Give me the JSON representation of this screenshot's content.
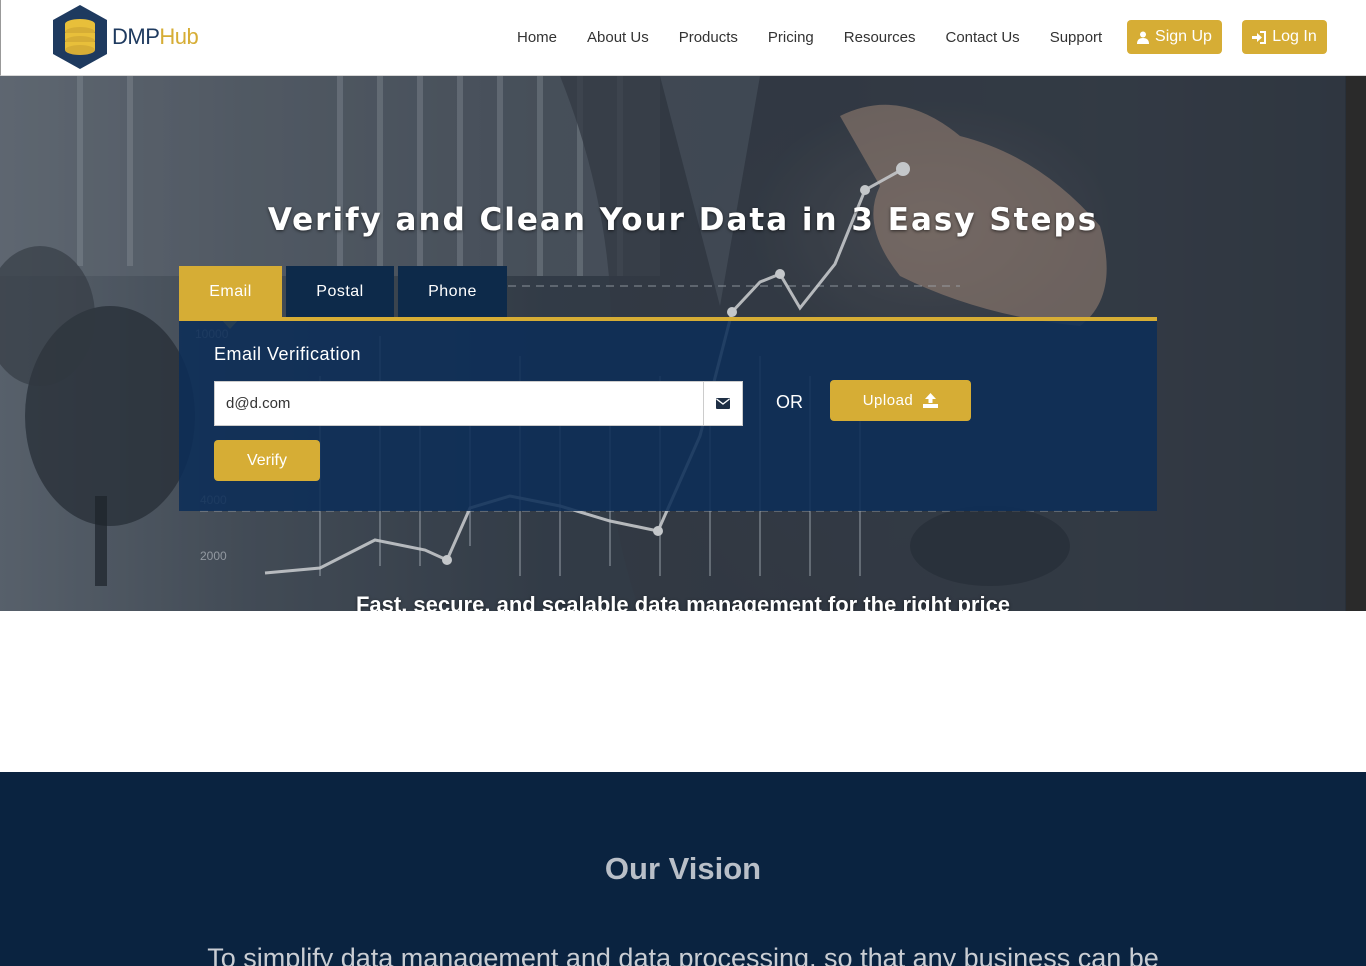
{
  "brand": {
    "name_part1": "DMP",
    "name_part2": "Hub",
    "logo_icon": "database-hexagon-icon",
    "primary_color": "#0c2d58",
    "accent_color": "#d6ad35"
  },
  "nav": {
    "items": [
      "Home",
      "About Us",
      "Products",
      "Pricing",
      "Resources",
      "Contact Us",
      "Support"
    ],
    "signup": {
      "label": "Sign Up",
      "icon": "user-icon"
    },
    "login": {
      "label": "Log In",
      "icon": "sign-in-icon"
    }
  },
  "hero": {
    "title": "Verify and Clean Your Data in 3 Easy Steps",
    "tagline": "Fast, secure, and scalable data management for the right price",
    "tabs": [
      "Email",
      "Postal",
      "Phone"
    ],
    "active_tab": "Email",
    "panel": {
      "title": "Email Verification",
      "email_value": "d@d.com",
      "email_icon": "envelope-icon",
      "or_label": "OR",
      "upload_label": "Upload",
      "upload_icon": "upload-icon",
      "verify_label": "Verify"
    },
    "chart_axis_labels": [
      "10000",
      "4000",
      "2000"
    ]
  },
  "vision": {
    "title": "Our Vision",
    "text": "To simplify data management and data processing, so that any business can be"
  }
}
